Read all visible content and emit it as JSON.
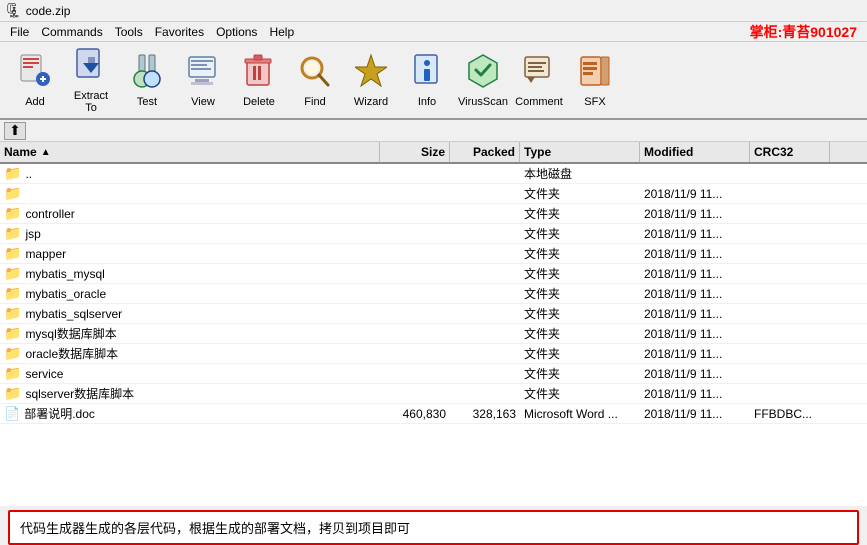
{
  "titleBar": {
    "icon": "🗜",
    "title": "code.zip"
  },
  "menuBar": {
    "items": [
      "File",
      "Commands",
      "Tools",
      "Favorites",
      "Options",
      "Help"
    ],
    "brand": "掌柜:青苔901027"
  },
  "toolbar": {
    "buttons": [
      {
        "label": "Add",
        "icon": "➕",
        "iconClass": "icon-add"
      },
      {
        "label": "Extract To",
        "icon": "📤",
        "iconClass": "icon-extract"
      },
      {
        "label": "Test",
        "icon": "🔬",
        "iconClass": "icon-test"
      },
      {
        "label": "View",
        "icon": "👁",
        "iconClass": "icon-view"
      },
      {
        "label": "Delete",
        "icon": "✖",
        "iconClass": "icon-delete"
      },
      {
        "label": "Find",
        "icon": "🔍",
        "iconClass": "icon-find"
      },
      {
        "label": "Wizard",
        "icon": "🧙",
        "iconClass": "icon-wizard"
      },
      {
        "label": "Info",
        "icon": "ℹ",
        "iconClass": "icon-info"
      },
      {
        "label": "VirusScan",
        "icon": "🛡",
        "iconClass": "icon-virus"
      },
      {
        "label": "Comment",
        "icon": "📝",
        "iconClass": "icon-comment"
      },
      {
        "label": "SFX",
        "icon": "📦",
        "iconClass": "icon-sfx"
      }
    ]
  },
  "columns": {
    "name": "Name",
    "size": "Size",
    "packed": "Packed",
    "type": "Type",
    "modified": "Modified",
    "crc": "CRC32"
  },
  "files": [
    {
      "name": "..",
      "size": "",
      "packed": "",
      "type": "本地磁盘",
      "modified": "",
      "crc": "",
      "icon": "folder"
    },
    {
      "name": "",
      "size": "",
      "packed": "",
      "type": "文件夹",
      "modified": "2018/11/9 11...",
      "crc": "",
      "icon": "folder"
    },
    {
      "name": "controller",
      "size": "",
      "packed": "",
      "type": "文件夹",
      "modified": "2018/11/9 11...",
      "crc": "",
      "icon": "folder"
    },
    {
      "name": "jsp",
      "size": "",
      "packed": "",
      "type": "文件夹",
      "modified": "2018/11/9 11...",
      "crc": "",
      "icon": "folder"
    },
    {
      "name": "mapper",
      "size": "",
      "packed": "",
      "type": "文件夹",
      "modified": "2018/11/9 11...",
      "crc": "",
      "icon": "folder"
    },
    {
      "name": "mybatis_mysql",
      "size": "",
      "packed": "",
      "type": "文件夹",
      "modified": "2018/11/9 11...",
      "crc": "",
      "icon": "folder"
    },
    {
      "name": "mybatis_oracle",
      "size": "",
      "packed": "",
      "type": "文件夹",
      "modified": "2018/11/9 11...",
      "crc": "",
      "icon": "folder"
    },
    {
      "name": "mybatis_sqlserver",
      "size": "",
      "packed": "",
      "type": "文件夹",
      "modified": "2018/11/9 11...",
      "crc": "",
      "icon": "folder"
    },
    {
      "name": "mysql数据库脚本",
      "size": "",
      "packed": "",
      "type": "文件夹",
      "modified": "2018/11/9 11...",
      "crc": "",
      "icon": "folder"
    },
    {
      "name": "oracle数据库脚本",
      "size": "",
      "packed": "",
      "type": "文件夹",
      "modified": "2018/11/9 11...",
      "crc": "",
      "icon": "folder"
    },
    {
      "name": "service",
      "size": "",
      "packed": "",
      "type": "文件夹",
      "modified": "2018/11/9 11...",
      "crc": "",
      "icon": "folder"
    },
    {
      "name": "sqlserver数据库脚本",
      "size": "",
      "packed": "",
      "type": "文件夹",
      "modified": "2018/11/9 11...",
      "crc": "",
      "icon": "folder"
    },
    {
      "name": "部署说明.doc",
      "size": "460,830",
      "packed": "328,163",
      "type": "Microsoft Word ...",
      "modified": "2018/11/9 11...",
      "crc": "FFBDBC...",
      "icon": "doc"
    }
  ],
  "bottomNote": "代码生成器生成的各层代码，根据生成的部署文档，拷贝到项目即可"
}
